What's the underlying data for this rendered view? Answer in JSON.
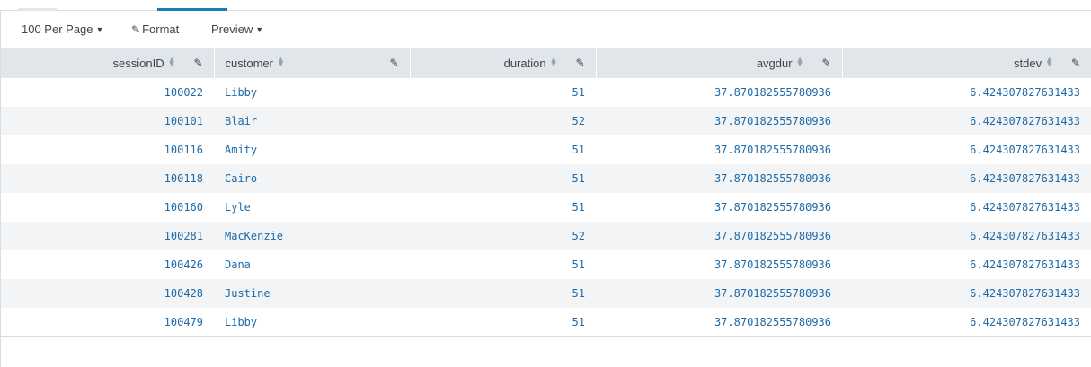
{
  "toolbar": {
    "per_page_label": "100 Per Page",
    "format_label": "Format",
    "preview_label": "Preview"
  },
  "columns": [
    {
      "label": "sessionID",
      "align": "right"
    },
    {
      "label": "customer",
      "align": "left"
    },
    {
      "label": "duration",
      "align": "right"
    },
    {
      "label": "avgdur",
      "align": "right"
    },
    {
      "label": "stdev",
      "align": "right"
    }
  ],
  "rows": [
    [
      "100022",
      "Libby",
      "51",
      "37.870182555780936",
      "6.424307827631433"
    ],
    [
      "100101",
      "Blair",
      "52",
      "37.870182555780936",
      "6.424307827631433"
    ],
    [
      "100116",
      "Amity",
      "51",
      "37.870182555780936",
      "6.424307827631433"
    ],
    [
      "100118",
      "Cairo",
      "51",
      "37.870182555780936",
      "6.424307827631433"
    ],
    [
      "100160",
      "Lyle",
      "51",
      "37.870182555780936",
      "6.424307827631433"
    ],
    [
      "100281",
      "MacKenzie",
      "52",
      "37.870182555780936",
      "6.424307827631433"
    ],
    [
      "100426",
      "Dana",
      "51",
      "37.870182555780936",
      "6.424307827631433"
    ],
    [
      "100428",
      "Justine",
      "51",
      "37.870182555780936",
      "6.424307827631433"
    ],
    [
      "100479",
      "Libby",
      "51",
      "37.870182555780936",
      "6.424307827631433"
    ]
  ],
  "icons": {
    "sort": "sort-icon",
    "edit": "pencil-icon",
    "dropdown": "caret-down-icon"
  },
  "colors": {
    "link_text": "#1e6aa8",
    "header_bg": "#e1e6eb",
    "stripe_bg": "#f2f4f5",
    "active_tab": "#1a7cb4"
  }
}
